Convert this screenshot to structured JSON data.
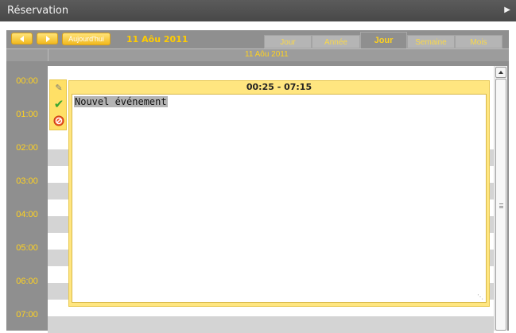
{
  "window": {
    "title": "Réservation"
  },
  "toolbar": {
    "today_label": "Aujourd'hui",
    "current_date": "11 Aôu 2011"
  },
  "tabs": [
    {
      "label": "Jour"
    },
    {
      "label": "Année"
    },
    {
      "label": "Jour"
    },
    {
      "label": "Semaine"
    },
    {
      "label": "Mois"
    }
  ],
  "day_header": {
    "date": "11 Aôu 2011"
  },
  "hours": [
    "00:00",
    "01:00",
    "02:00",
    "03:00",
    "04:00",
    "05:00",
    "06:00",
    "07:00"
  ],
  "event": {
    "time_range": "00:25 - 07:15",
    "text": "Nouvel événement"
  },
  "icons": {
    "edit": "pencil-icon",
    "save": "checkmark-icon",
    "delete": "cancel-icon",
    "next": "chevron-right-icon"
  },
  "colors": {
    "accent": "#ffd21f",
    "event_bg": "#ffe680",
    "frame": "#8f8f8f",
    "titlebar": "#4f4f4f"
  }
}
